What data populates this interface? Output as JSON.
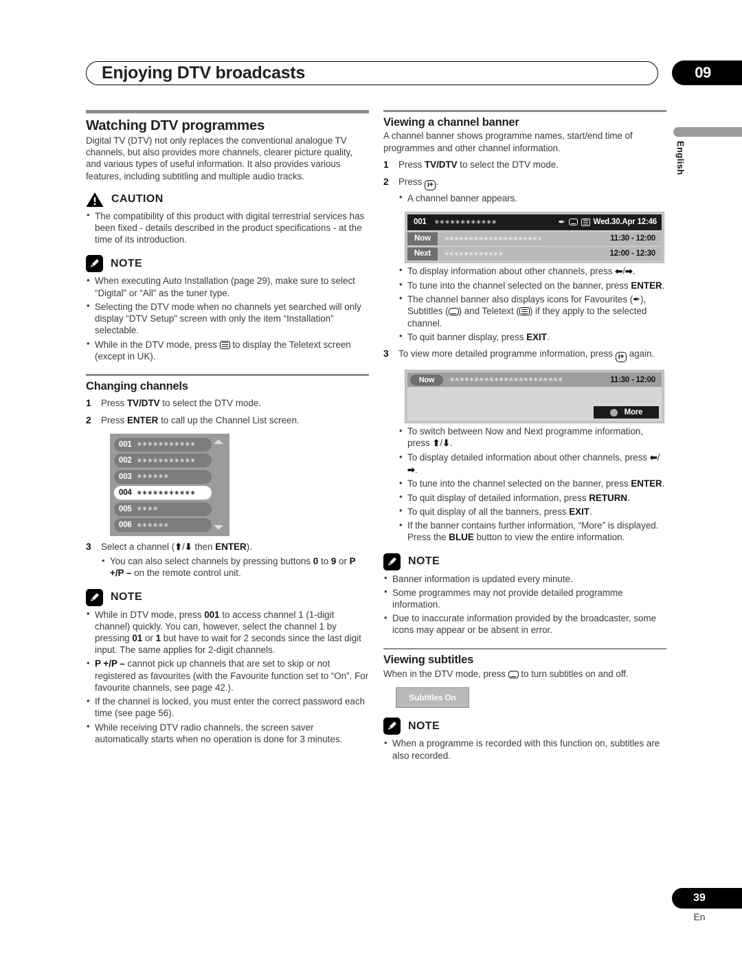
{
  "header": {
    "title": "Enjoying DTV broadcasts",
    "chapter": "09"
  },
  "side_tab": {
    "language": "English"
  },
  "footer": {
    "page_number": "39",
    "language_code": "En"
  },
  "labels": {
    "caution": "CAUTION",
    "note": "NOTE"
  },
  "left_column": {
    "section_title": "Watching DTV programmes",
    "intro": "Digital TV (DTV) not only replaces the conventional analogue TV channels, but also provides more channels, clearer picture quality, and various types of useful information. It also provides various features, including subtitling and multiple audio tracks.",
    "caution_bullets": [
      "The compatibility of this product with digital terrestrial services has been fixed - details described in the product specifications - at the time of its introduction."
    ],
    "note_bullets": [
      "When executing Auto Installation (page 29), make sure to select “Digital” or “All” as the tuner type.",
      "Selecting the DTV mode when no channels yet searched will only display “DTV Setup” screen with only the item “Installation” selectable.",
      "While in the DTV mode, press [teletext-icon] to display the Teletext screen (except in UK)."
    ],
    "changing_channels": {
      "title": "Changing channels",
      "steps": [
        {
          "num": "1",
          "text": "Press TV/DTV to select the DTV mode."
        },
        {
          "num": "2",
          "text": "Press ENTER to call up the Channel List screen."
        },
        {
          "num": "3",
          "text": "Select a channel (up/down then ENTER)."
        }
      ],
      "step3_bullets": [
        "You can also select channels by pressing buttons 0 to 9 or P +/P – on the remote control unit."
      ],
      "channel_list": {
        "rows": [
          {
            "number": "001",
            "stars": "∗∗∗∗∗∗∗∗∗∗∗",
            "selected": false
          },
          {
            "number": "002",
            "stars": "∗∗∗∗∗∗∗∗∗∗∗",
            "selected": false
          },
          {
            "number": "003",
            "stars": "∗∗∗∗∗∗",
            "selected": false
          },
          {
            "number": "004",
            "stars": "∗∗∗∗∗∗∗∗∗∗∗",
            "selected": true
          },
          {
            "number": "005",
            "stars": "∗∗∗∗",
            "selected": false
          },
          {
            "number": "006",
            "stars": "∗∗∗∗∗∗",
            "selected": false
          }
        ]
      },
      "note_bullets": [
        "While in DTV mode, press 001 to access channel 1 (1-digit channel) quickly. You can, however, select the channel 1 by pressing 01 or 1 but have to wait for 2 seconds since the last digit input. The same applies for 2-digit channels.",
        "P +/P – cannot pick up channels that are set to skip or not registered as favourites (with the Favourite function set to “On”. For favourite channels, see page 42.).",
        "If the channel is locked, you must enter the correct password each time (see page 56).",
        "While receiving DTV radio channels, the screen saver automatically starts when no operation is done for 3 minutes."
      ]
    }
  },
  "right_column": {
    "channel_banner": {
      "title": "Viewing a channel banner",
      "intro": "A channel banner shows programme names, start/end time of programmes and other channel information.",
      "steps": [
        {
          "num": "1",
          "text": "Press TV/DTV to select the DTV mode."
        },
        {
          "num": "2",
          "text": "Press [info-plus-icon]."
        },
        {
          "num": "3",
          "text": "To view more detailed programme information, press [info-plus-icon] again."
        }
      ],
      "step2_bullets": [
        "A channel banner appears."
      ],
      "banner_graphic": {
        "channel_number": "001",
        "channel_stars": "∗∗∗∗∗∗∗∗∗∗∗∗",
        "datetime": "Wed.30.Apr 12:46",
        "icons": [
          "favourite-icon",
          "subtitles-icon",
          "teletext-icon"
        ],
        "rows": [
          {
            "tag": "Now",
            "stars": "∗∗∗∗∗∗∗∗∗∗∗∗∗∗∗∗∗∗∗∗",
            "time": "11:30 - 12:00"
          },
          {
            "tag": "Next",
            "stars": "∗∗∗∗∗∗∗∗∗∗∗∗",
            "time": "12:00 - 12:30"
          }
        ]
      },
      "bullets_after_banner": [
        "To display information about other channels, press left/right.",
        "To tune into the channel selected on the banner, press ENTER.",
        "The channel banner also displays icons for Favourites (fav), Subtitles (sub) and Teletext (tel) if they apply to the selected channel.",
        "To quit banner display, press EXIT."
      ],
      "detail_graphic": {
        "tag": "Now",
        "stars": "∗∗∗∗∗∗∗∗∗∗∗∗∗∗∗∗∗∗∗∗∗∗∗",
        "time": "11:30 - 12:00",
        "more_label": "More"
      },
      "bullets_after_detail": [
        "To switch between Now and Next programme information, press up/down.",
        "To display detailed information about other channels, press left/right.",
        "To tune into the channel selected on the banner, press ENTER.",
        "To quit display of detailed information, press RETURN.",
        "To quit display of all the banners, press EXIT.",
        "If the banner contains further information, “More” is displayed. Press the BLUE button to view the entire information."
      ],
      "note_bullets": [
        "Banner information is updated every minute.",
        "Some programmes may not provide detailed programme information.",
        "Due to inaccurate information provided by the broadcaster, some icons may appear or be absent in error."
      ]
    },
    "subtitles": {
      "title": "Viewing subtitles",
      "intro": "When in the DTV mode, press [subtitles-icon] to turn subtitles on and off.",
      "box_label": "Subtitles On",
      "note_bullets": [
        "When a programme is recorded with this function on, subtitles are also recorded."
      ]
    }
  }
}
